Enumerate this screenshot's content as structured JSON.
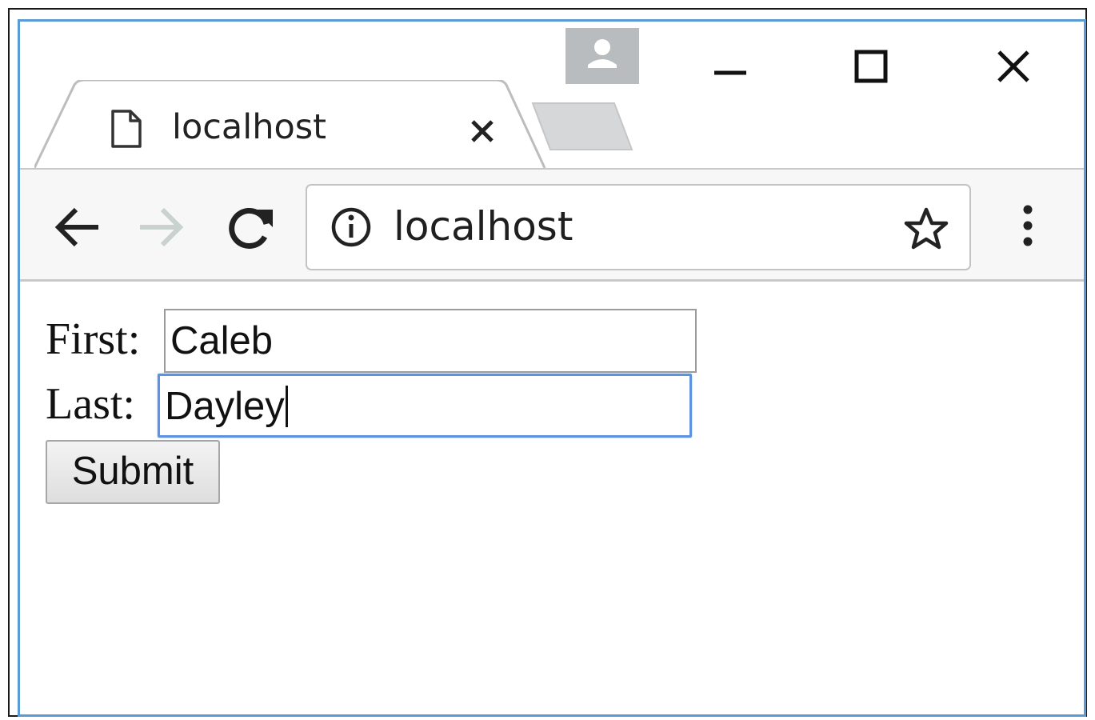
{
  "tab": {
    "title": "localhost"
  },
  "address_bar": {
    "url": "localhost"
  },
  "form": {
    "first_label": "First:",
    "first_value": "Caleb",
    "last_label": "Last:",
    "last_value": "Dayley",
    "submit_label": "Submit"
  },
  "icons": {
    "profile": "person-icon",
    "minimize": "minimize-icon",
    "maximize": "maximize-icon",
    "close": "close-icon",
    "tab_page": "page-icon",
    "tab_close": "close-icon",
    "back": "arrow-left-icon",
    "forward": "arrow-right-icon",
    "reload": "reload-icon",
    "site_info": "info-icon",
    "bookmark": "star-icon",
    "menu": "kebab-menu-icon"
  },
  "colors": {
    "window_border": "#5b9bd5",
    "focus_ring": "#5e92e0",
    "forward_disabled": "#c9d2cf"
  }
}
